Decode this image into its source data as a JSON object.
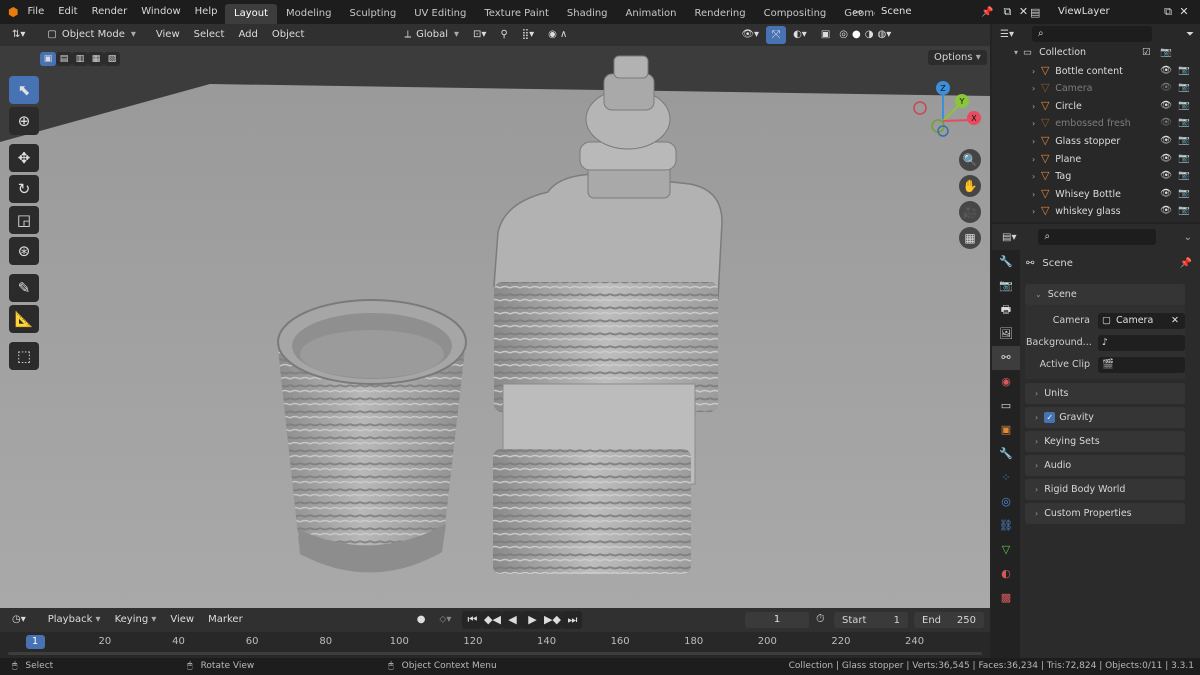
{
  "topbar": {
    "menus": [
      "File",
      "Edit",
      "Render",
      "Window",
      "Help"
    ],
    "workspaces": [
      "Layout",
      "Modeling",
      "Sculpting",
      "UV Editing",
      "Texture Paint",
      "Shading",
      "Animation",
      "Rendering",
      "Compositing",
      "Geometry Noc"
    ],
    "active_workspace": "Layout",
    "scene_label": "Scene",
    "viewlayer_label": "ViewLayer"
  },
  "viewport_header": {
    "mode": "Object Mode",
    "menus": [
      "View",
      "Select",
      "Add",
      "Object"
    ],
    "orientation": "Global",
    "options_label": "Options"
  },
  "gizmo": {
    "x": "X",
    "y": "Y",
    "z": "Z"
  },
  "timeline": {
    "menus": [
      "Playback",
      "Keying",
      "View",
      "Marker"
    ],
    "current_frame": "1",
    "start_label": "Start",
    "start_value": "1",
    "end_label": "End",
    "end_value": "250",
    "ticks": [
      "1",
      "20",
      "40",
      "60",
      "80",
      "100",
      "120",
      "140",
      "160",
      "180",
      "200",
      "220",
      "240"
    ]
  },
  "statusbar": {
    "select": "Select",
    "rotate": "Rotate View",
    "context": "Object Context Menu",
    "stats": "Collection | Glass stopper | Verts:36,545 | Faces:36,234 | Tris:72,824 | Objects:0/11 | 3.3.1"
  },
  "outliner": {
    "collection": "Collection",
    "items": [
      {
        "name": "Bottle content",
        "dim": false
      },
      {
        "name": "Camera",
        "dim": true
      },
      {
        "name": "Circle",
        "dim": false
      },
      {
        "name": "embossed fresh",
        "dim": true
      },
      {
        "name": "Glass stopper",
        "dim": false
      },
      {
        "name": "Plane",
        "dim": false
      },
      {
        "name": "Tag",
        "dim": false
      },
      {
        "name": "Whisey Bottle",
        "dim": false
      },
      {
        "name": "whiskey glass",
        "dim": false
      }
    ]
  },
  "properties": {
    "context_title": "Scene",
    "scene_panel": "Scene",
    "camera_label": "Camera",
    "camera_value": "Camera",
    "background_label": "Background...",
    "active_clip_label": "Active Clip",
    "panels": [
      "Units",
      "Gravity",
      "Keying Sets",
      "Audio",
      "Rigid Body World",
      "Custom Properties"
    ]
  },
  "colors": {
    "accent": "#4772b3",
    "orange_object": "#e0893b",
    "axis_x": "#e84a5f",
    "axis_y": "#8ac53a",
    "axis_z": "#3d8fdb"
  }
}
